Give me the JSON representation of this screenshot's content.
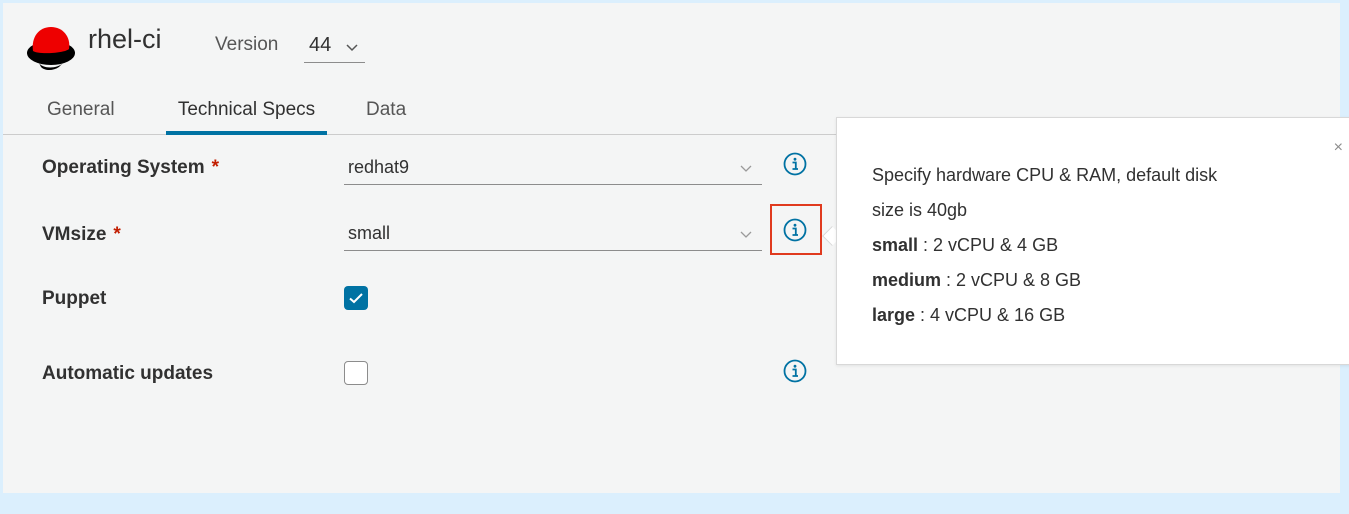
{
  "header": {
    "app_title": "rhel-ci",
    "version_label": "Version",
    "version_value": "44"
  },
  "tabs": [
    {
      "label": "General",
      "active": false
    },
    {
      "label": "Technical Specs",
      "active": true
    },
    {
      "label": "Data",
      "active": false
    }
  ],
  "form": {
    "operating_system": {
      "label": "Operating System",
      "required_mark": "*",
      "value": "redhat9"
    },
    "vmsize": {
      "label": "VMsize",
      "required_mark": "*",
      "value": "small"
    },
    "puppet": {
      "label": "Puppet",
      "checked": true
    },
    "automatic_updates": {
      "label": "Automatic updates",
      "checked": false
    }
  },
  "popover": {
    "description_line1": "Specify hardware CPU & RAM, default disk",
    "description_line2": "size is 40gb",
    "sizes": [
      {
        "name": "small",
        "spec": " : 2 vCPU & 4 GB"
      },
      {
        "name": "medium",
        "spec": " : 2 vCPU & 8 GB"
      },
      {
        "name": "large",
        "spec": " : 4 vCPU & 16 GB"
      }
    ],
    "close_glyph": "×"
  },
  "colors": {
    "accent": "#0072a3",
    "required": "#c21d00",
    "highlight": "#e03a1e",
    "page_background": "#dbeffd"
  },
  "icons": [
    "redhat-logo",
    "chevron-down-icon",
    "info-icon",
    "checkmark-icon",
    "close-icon"
  ]
}
